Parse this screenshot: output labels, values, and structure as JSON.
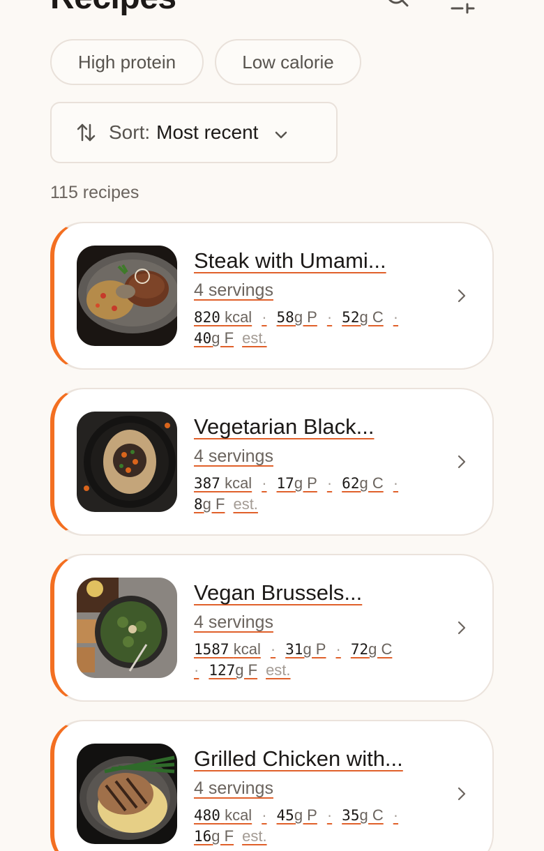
{
  "header": {
    "title": "Recipes",
    "search_icon": "search-icon",
    "filter_icon": "sliders-icon"
  },
  "filters": [
    {
      "label": "High protein"
    },
    {
      "label": "Low calorie"
    }
  ],
  "sort": {
    "prefix": "Sort:",
    "value": "Most recent",
    "icon": "sort-arrows-icon"
  },
  "count_label": "115 recipes",
  "colors": {
    "accent": "#f36f21",
    "background": "#fcf9f5",
    "card_border": "#ebe3dc"
  },
  "recipes": [
    {
      "title": "Steak with Umami...",
      "servings": "4 servings",
      "kcal_value": "820",
      "kcal_unit": "kcal",
      "p_value": "58",
      "p_unit": "g P",
      "c_value": "52",
      "c_unit": "g C",
      "f_value": "40",
      "f_unit": "g F",
      "sep": "·",
      "est": "est."
    },
    {
      "title": "Vegetarian Black...",
      "servings": "4 servings",
      "kcal_value": "387",
      "kcal_unit": "kcal",
      "p_value": "17",
      "p_unit": "g P",
      "c_value": "62",
      "c_unit": "g C",
      "f_value": "8",
      "f_unit": "g F",
      "sep": "·",
      "est": "est."
    },
    {
      "title": "Vegan Brussels...",
      "servings": "4 servings",
      "kcal_value": "1587",
      "kcal_unit": "kcal",
      "p_value": "31",
      "p_unit": "g P",
      "c_value": "72",
      "c_unit": "g C",
      "f_value": "127",
      "f_unit": "g F",
      "sep": "·",
      "est": "est."
    },
    {
      "title": "Grilled Chicken with...",
      "servings": "4 servings",
      "kcal_value": "480",
      "kcal_unit": "kcal",
      "p_value": "45",
      "p_unit": "g P",
      "c_value": "35",
      "c_unit": "g C",
      "f_value": "16",
      "f_unit": "g F",
      "sep": "·",
      "est": "est."
    }
  ]
}
